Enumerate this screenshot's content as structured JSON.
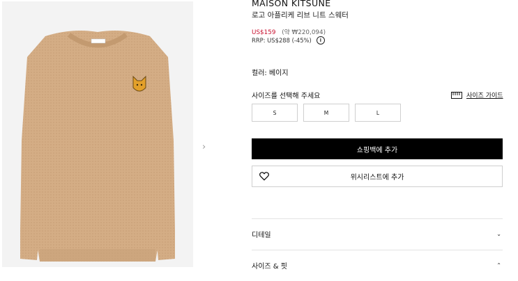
{
  "product": {
    "brand": "MAISON KITSUNÉ",
    "name": "로고 아플리케 리브 니트 스웨터",
    "sale_price": "US$159",
    "approx_price": "(약 ₩220,094)",
    "rrp": "RRP: US$288 (-45%)",
    "color_label": "컬러: 베이지",
    "sweater_color": "#d4ad85"
  },
  "size": {
    "prompt": "사이즈를 선택해 주세요",
    "guide_label": "사이즈 가이드",
    "options": [
      "S",
      "M",
      "L"
    ]
  },
  "actions": {
    "add_to_bag": "쇼핑백에 추가",
    "add_to_wishlist": "위시리스트에 추가"
  },
  "accordion": [
    {
      "label": "디테일",
      "state": "collapsed"
    },
    {
      "label": "사이즈 & 핏",
      "state": "expanded"
    }
  ],
  "icons": {
    "next": "chevron-right-icon",
    "info": "info-icon",
    "ruler": "ruler-icon",
    "heart": "heart-icon"
  }
}
